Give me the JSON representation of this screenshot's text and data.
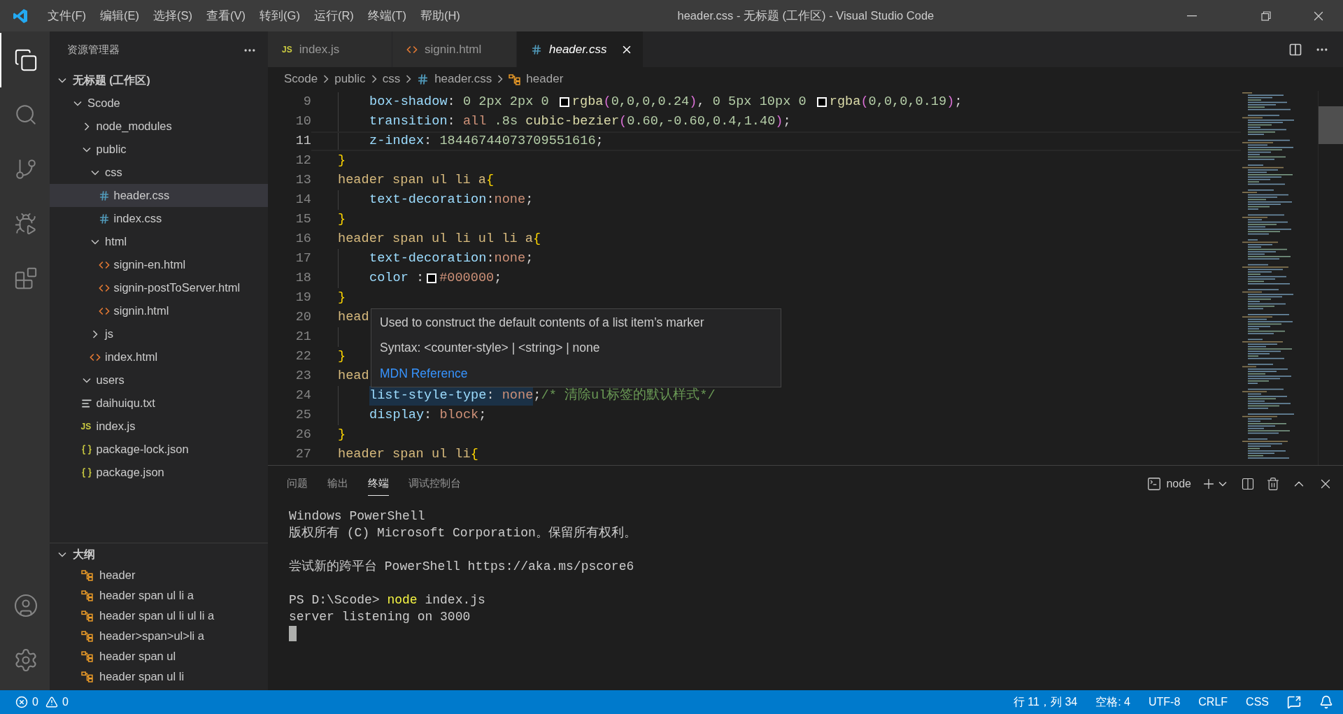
{
  "title_bar": {
    "menu": [
      "文件(F)",
      "编辑(E)",
      "选择(S)",
      "查看(V)",
      "转到(G)",
      "运行(R)",
      "终端(T)",
      "帮助(H)"
    ],
    "title": "header.css - 无标题 (工作区) - Visual Studio Code"
  },
  "activity_bar": [
    {
      "kind": "explorer",
      "selected": true
    },
    {
      "kind": "search",
      "selected": false
    },
    {
      "kind": "scm",
      "selected": false
    },
    {
      "kind": "debug",
      "selected": false
    },
    {
      "kind": "extensions",
      "selected": false
    }
  ],
  "activity_bar_bottom": [
    {
      "kind": "account"
    },
    {
      "kind": "settings"
    }
  ],
  "sidebar": {
    "title": "资源管理器",
    "workspace": {
      "label": "无标题 (工作区)",
      "expanded": true
    },
    "tree": [
      {
        "label": "Scode",
        "kind": "folder",
        "expanded": true,
        "selected": false,
        "children": [
          {
            "label": "node_modules",
            "kind": "folder",
            "expanded": false,
            "selected": false
          },
          {
            "label": "public",
            "kind": "folder",
            "expanded": true,
            "selected": false,
            "children": [
              {
                "label": "css",
                "kind": "folder",
                "expanded": true,
                "selected": false,
                "children": [
                  {
                    "label": "header.css",
                    "kind": "css",
                    "selected": true
                  },
                  {
                    "label": "index.css",
                    "kind": "css",
                    "selected": false
                  }
                ]
              },
              {
                "label": "html",
                "kind": "folder",
                "expanded": true,
                "selected": false,
                "children": [
                  {
                    "label": "signin-en.html",
                    "kind": "html",
                    "selected": false
                  },
                  {
                    "label": "signin-postToServer.html",
                    "kind": "html",
                    "selected": false
                  },
                  {
                    "label": "signin.html",
                    "kind": "html",
                    "selected": false
                  }
                ]
              },
              {
                "label": "js",
                "kind": "folder",
                "expanded": false,
                "selected": false
              },
              {
                "label": "index.html",
                "kind": "html",
                "selected": false
              }
            ]
          },
          {
            "label": "users",
            "kind": "folder",
            "expanded": true,
            "selected": false
          },
          {
            "label": "daihuiqu.txt",
            "kind": "txt",
            "selected": false
          },
          {
            "label": "index.js",
            "kind": "js",
            "icon_text": "JS",
            "selected": false
          },
          {
            "label": "package-lock.json",
            "kind": "json",
            "selected": false
          },
          {
            "label": "package.json",
            "kind": "json",
            "selected": false
          }
        ]
      }
    ],
    "outline": {
      "title": "大纲",
      "expanded": true,
      "items": [
        "header",
        "header span ul li a",
        "header span ul li ul li a",
        "header>span>ul>li a",
        "header span ul",
        "header span ul li"
      ]
    }
  },
  "editor": {
    "tabs": [
      {
        "label": "index.js",
        "kind": "js",
        "icon_text": "JS",
        "selected": false,
        "preview": false
      },
      {
        "label": "signin.html",
        "kind": "html",
        "selected": false,
        "preview": false
      },
      {
        "label": "header.css",
        "kind": "css",
        "selected": true,
        "preview": true
      }
    ],
    "breadcrumb": [
      {
        "label": "Scode",
        "kind": "folder"
      },
      {
        "label": "public",
        "kind": "folder"
      },
      {
        "label": "css",
        "kind": "folder"
      },
      {
        "label": "header.css",
        "kind": "css"
      },
      {
        "label": "header",
        "kind": "symbol"
      }
    ],
    "lines": [
      {
        "number": "9",
        "kind": "decl",
        "current": false,
        "tokens": [
          {
            "kind": "prop",
            "text": "box-shadow"
          },
          {
            "kind": "punct",
            "text": ": "
          },
          {
            "kind": "number",
            "text": "0 2px 2px 0 "
          },
          {
            "kind": "swatch",
            "color": "#000000"
          },
          {
            "kind": "func",
            "text": "rgba"
          },
          {
            "kind": "paren",
            "text": "("
          },
          {
            "kind": "number",
            "text": "0,0,0,0.24"
          },
          {
            "kind": "paren",
            "text": ")"
          },
          {
            "kind": "punct",
            "text": ", "
          },
          {
            "kind": "number",
            "text": "0 5px 10px 0 "
          },
          {
            "kind": "swatch",
            "color": "#000000"
          },
          {
            "kind": "func",
            "text": "rgba"
          },
          {
            "kind": "paren",
            "text": "("
          },
          {
            "kind": "number",
            "text": "0,0,0,0.19"
          },
          {
            "kind": "paren",
            "text": ")"
          },
          {
            "kind": "punct",
            "text": ";"
          }
        ]
      },
      {
        "number": "10",
        "kind": "decl",
        "current": false,
        "tokens": [
          {
            "kind": "prop",
            "text": "transition"
          },
          {
            "kind": "punct",
            "text": ": "
          },
          {
            "kind": "value",
            "text": "all "
          },
          {
            "kind": "number",
            "text": ".8s "
          },
          {
            "kind": "func",
            "text": "cubic-bezier"
          },
          {
            "kind": "paren",
            "text": "("
          },
          {
            "kind": "number",
            "text": "0.60,-0.60,0.4,1.40"
          },
          {
            "kind": "paren",
            "text": ")"
          },
          {
            "kind": "punct",
            "text": ";"
          }
        ]
      },
      {
        "number": "11",
        "kind": "decl",
        "current": true,
        "tokens": [
          {
            "kind": "prop",
            "text": "z-index"
          },
          {
            "kind": "punct",
            "text": ": "
          },
          {
            "kind": "number",
            "text": "18446744073709551616"
          },
          {
            "kind": "punct",
            "text": ";"
          }
        ]
      },
      {
        "number": "12",
        "kind": "rule",
        "current": false,
        "tokens": [
          {
            "kind": "brace",
            "text": "}"
          }
        ]
      },
      {
        "number": "13",
        "kind": "rule",
        "current": false,
        "tokens": [
          {
            "kind": "selector",
            "text": "header span ul li a"
          },
          {
            "kind": "brace",
            "text": "{"
          }
        ]
      },
      {
        "number": "14",
        "kind": "decl",
        "current": false,
        "tokens": [
          {
            "kind": "prop",
            "text": "text-decoration"
          },
          {
            "kind": "punct",
            "text": ":"
          },
          {
            "kind": "value",
            "text": "none"
          },
          {
            "kind": "punct",
            "text": ";"
          }
        ]
      },
      {
        "number": "15",
        "kind": "rule",
        "current": false,
        "tokens": [
          {
            "kind": "brace",
            "text": "}"
          }
        ]
      },
      {
        "number": "16",
        "kind": "rule",
        "current": false,
        "tokens": [
          {
            "kind": "selector",
            "text": "header span ul li ul li a"
          },
          {
            "kind": "brace",
            "text": "{"
          }
        ]
      },
      {
        "number": "17",
        "kind": "decl",
        "current": false,
        "tokens": [
          {
            "kind": "prop",
            "text": "text-decoration"
          },
          {
            "kind": "punct",
            "text": ":"
          },
          {
            "kind": "value",
            "text": "none"
          },
          {
            "kind": "punct",
            "text": ";"
          }
        ]
      },
      {
        "number": "18",
        "kind": "decl",
        "current": false,
        "tokens": [
          {
            "kind": "prop",
            "text": "color"
          },
          {
            "kind": "punct",
            "text": " :"
          },
          {
            "kind": "swatch",
            "color": "#000000"
          },
          {
            "kind": "value",
            "text": "#000000"
          },
          {
            "kind": "punct",
            "text": ";"
          }
        ]
      },
      {
        "number": "19",
        "kind": "rule",
        "current": false,
        "tokens": [
          {
            "kind": "brace",
            "text": "}"
          }
        ]
      },
      {
        "number": "20",
        "kind": "rule",
        "current": false,
        "tokens": [
          {
            "kind": "selector",
            "text": "head"
          }
        ]
      },
      {
        "number": "21",
        "kind": "decl",
        "current": false
      },
      {
        "number": "22",
        "kind": "rule",
        "current": false,
        "tokens": [
          {
            "kind": "brace",
            "text": "}"
          }
        ]
      },
      {
        "number": "23",
        "kind": "rule",
        "current": false,
        "tokens": [
          {
            "kind": "selector",
            "text": "head"
          }
        ]
      },
      {
        "number": "24",
        "kind": "decl",
        "current": false,
        "tokens": [
          {
            "kind": "prop",
            "text": "list-style-type",
            "hover": true
          },
          {
            "kind": "punct",
            "text": ": ",
            "hover": true
          },
          {
            "kind": "value",
            "text": "none",
            "hover": true
          },
          {
            "kind": "punct",
            "text": ";",
            "hover": false
          },
          {
            "kind": "comment",
            "text": "/* 清除ul标签的默认样式*/",
            "hover": false
          }
        ]
      },
      {
        "number": "25",
        "kind": "decl",
        "current": false,
        "tokens": [
          {
            "kind": "prop",
            "text": "display"
          },
          {
            "kind": "punct",
            "text": ": "
          },
          {
            "kind": "value",
            "text": "block"
          },
          {
            "kind": "punct",
            "text": ";"
          }
        ]
      },
      {
        "number": "26",
        "kind": "rule",
        "current": false,
        "tokens": [
          {
            "kind": "brace",
            "text": "}"
          }
        ]
      },
      {
        "number": "27",
        "kind": "rule",
        "current": false,
        "tokens": [
          {
            "kind": "selector",
            "text": "header span ul li"
          },
          {
            "kind": "brace",
            "text": "{"
          }
        ]
      }
    ],
    "hover_tooltip": {
      "description": "Used to construct the default contents of a list item’s marker",
      "syntax": "Syntax: <counter-style> | <string> | none",
      "link": "MDN Reference"
    }
  },
  "panel": {
    "tabs": [
      {
        "label": "问题",
        "selected": false
      },
      {
        "label": "输出",
        "selected": false
      },
      {
        "label": "终端",
        "selected": true
      },
      {
        "label": "调试控制台",
        "selected": false
      }
    ],
    "terminal_name": "node",
    "lines": [
      {
        "kind": "text",
        "tokens": [
          {
            "kind": "plain",
            "text": "Windows PowerShell"
          }
        ]
      },
      {
        "kind": "text",
        "tokens": [
          {
            "kind": "plain",
            "text": "版权所有 (C) Microsoft Corporation。保留所有权利。"
          }
        ]
      },
      {
        "kind": "blank"
      },
      {
        "kind": "text",
        "tokens": [
          {
            "kind": "plain",
            "text": "尝试新的跨平台 PowerShell https://aka.ms/pscore6"
          }
        ]
      },
      {
        "kind": "blank"
      },
      {
        "kind": "text",
        "tokens": [
          {
            "kind": "plain",
            "text": "PS D:\\Scode> "
          },
          {
            "kind": "command",
            "text": "node"
          },
          {
            "kind": "plain",
            "text": " index.js"
          }
        ]
      },
      {
        "kind": "text",
        "tokens": [
          {
            "kind": "plain",
            "text": "server listening on 3000"
          }
        ]
      },
      {
        "kind": "cursor"
      }
    ]
  },
  "status_bar": {
    "errors": "0",
    "warnings": "0",
    "items": [
      "行 11，列 34",
      "空格: 4",
      "UTF-8",
      "CRLF",
      "CSS"
    ]
  }
}
